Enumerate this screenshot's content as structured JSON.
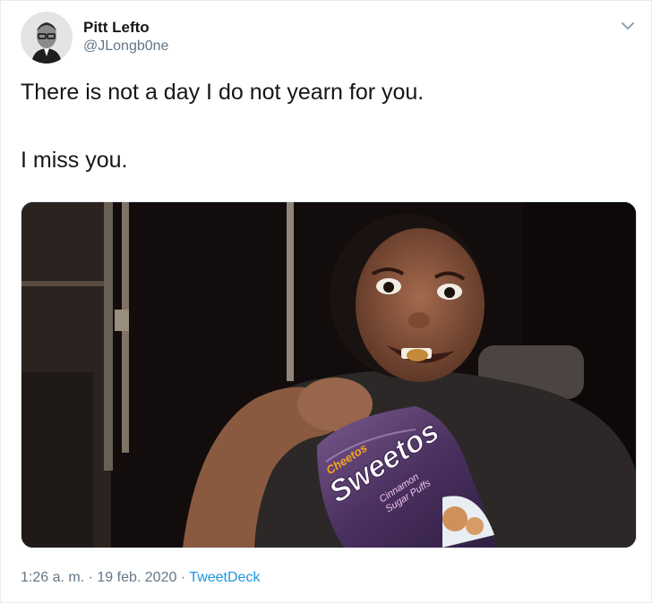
{
  "author": {
    "display_name": "Pitt Lefto",
    "handle": "@JLongb0ne"
  },
  "menu": {
    "icon": "chevron-down-icon"
  },
  "tweet": {
    "line1": "There is not a day I do not yearn for you.",
    "line2": "I miss you."
  },
  "media": {
    "bag_text": {
      "brand": "Cheetos",
      "product": "Sweetos",
      "flavor_1": "Cinnamon",
      "flavor_2": "Sugar Puffs"
    }
  },
  "footer": {
    "time": "1:26 a. m.",
    "separator": "·",
    "date": "19 feb. 2020",
    "source": "TweetDeck"
  },
  "colors": {
    "text": "#14171a",
    "secondary": "#657786",
    "link": "#1b95e0",
    "border": "#e6ecf0"
  }
}
